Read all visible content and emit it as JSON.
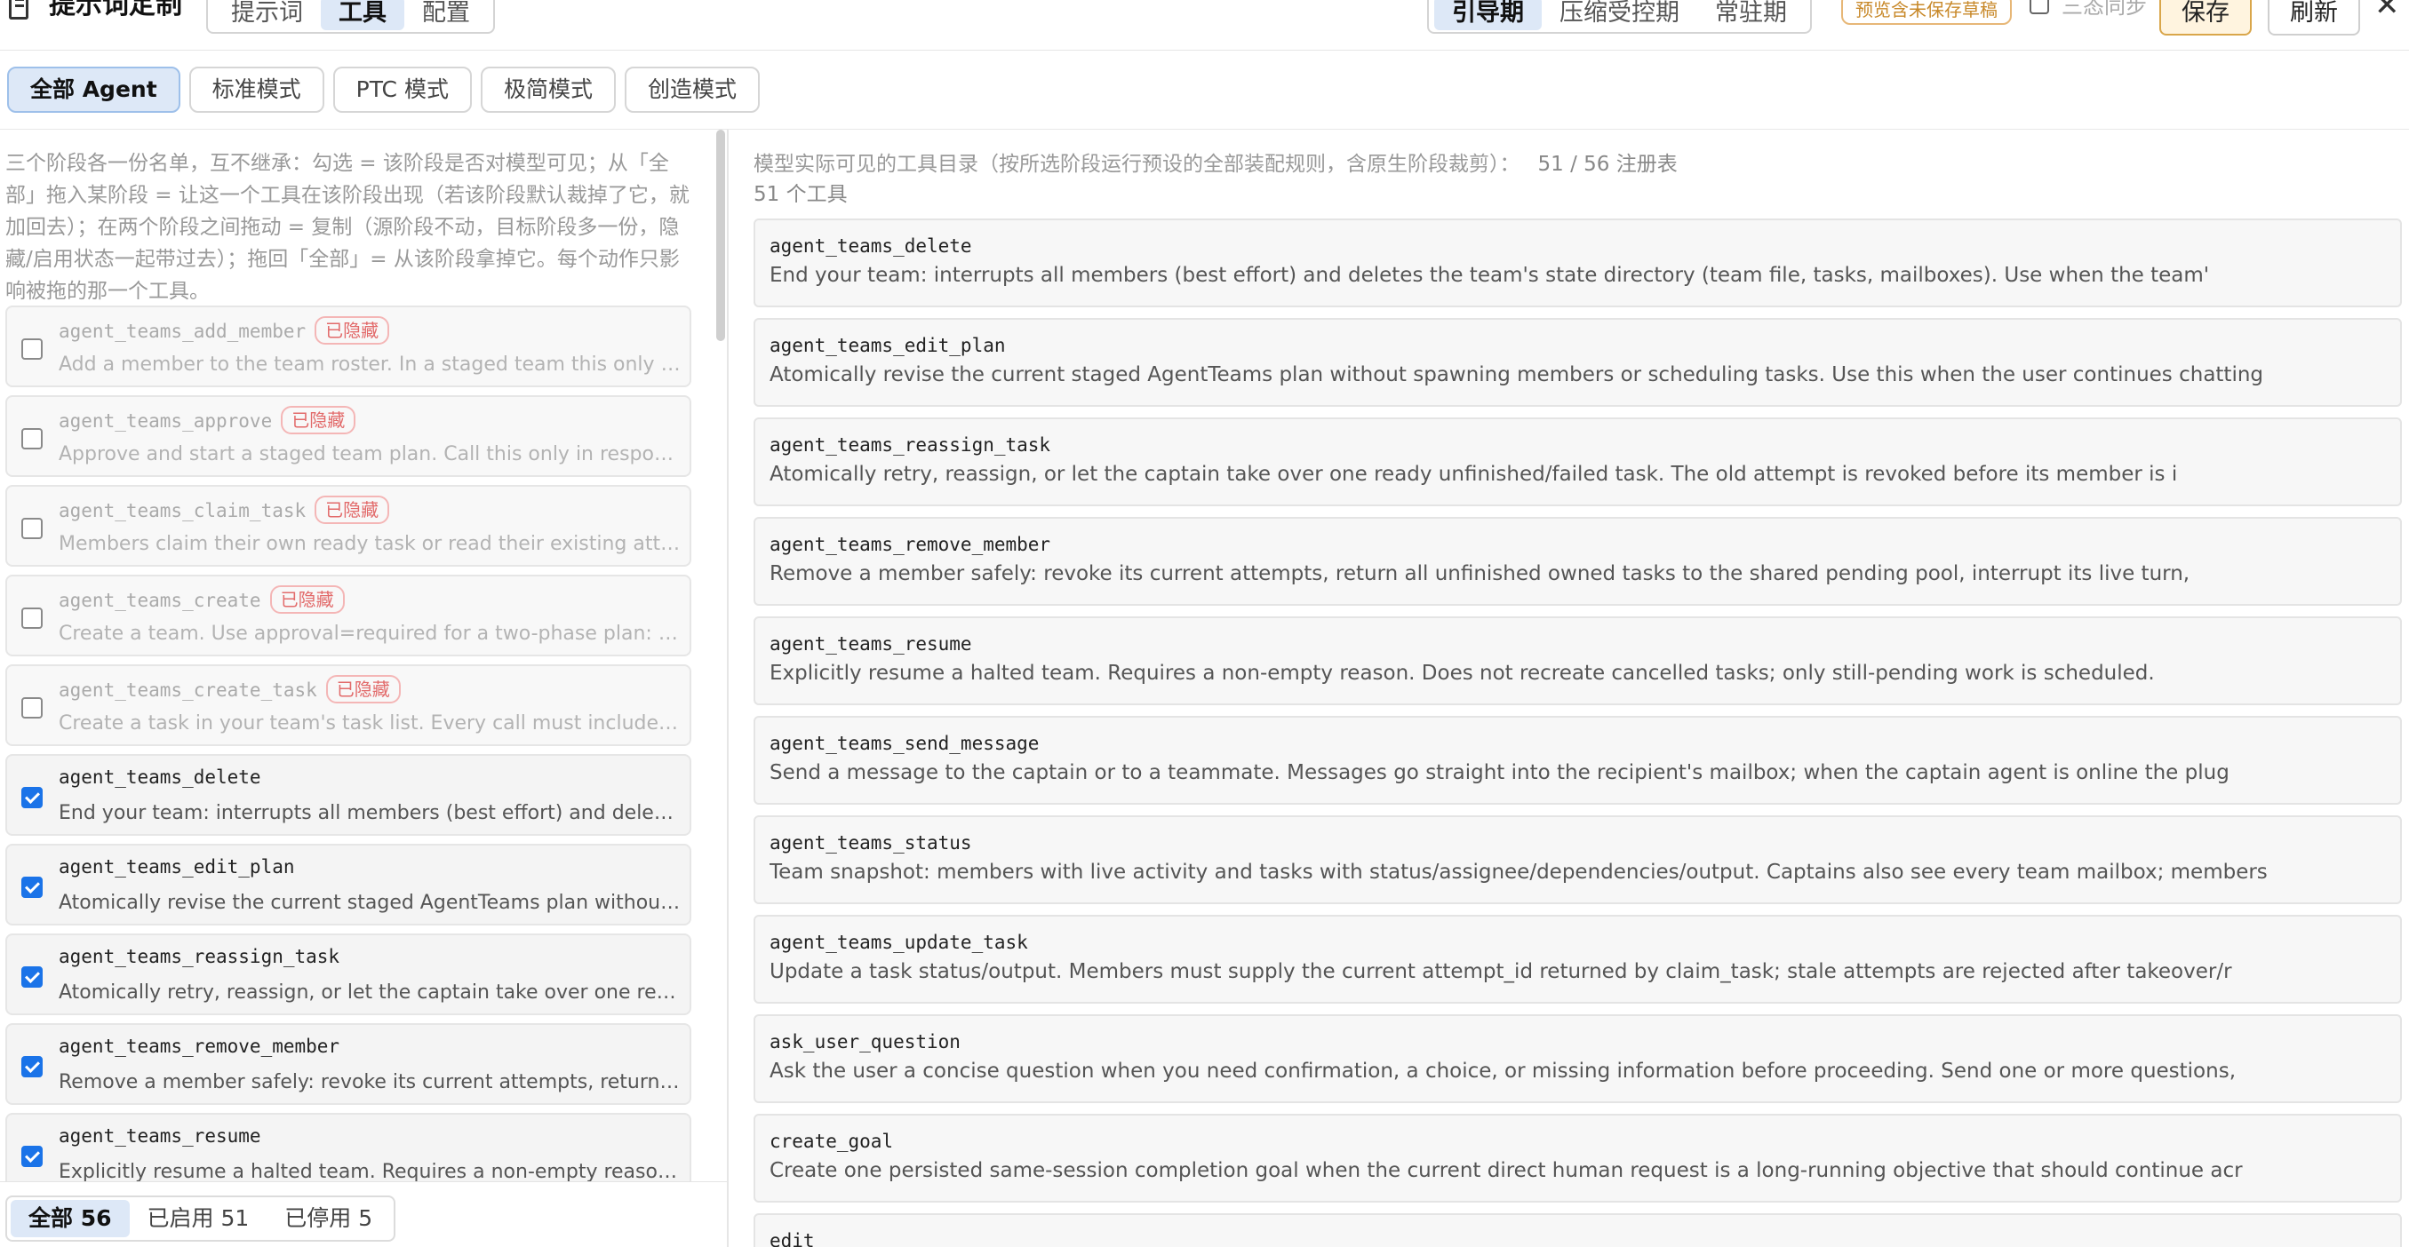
{
  "app": {
    "title": "提示词定制",
    "main_tabs": [
      "提示词",
      "工具",
      "配置"
    ],
    "phase_tabs": [
      "引导期",
      "压缩受控期",
      "常驻期"
    ],
    "draft_badge": "预览含未保存草稿",
    "sync_label": "三态同步",
    "save_label": "保存",
    "refresh_label": "刷新",
    "close_glyph": "✕"
  },
  "modes": [
    "全部 Agent",
    "标准模式",
    "PTC 模式",
    "极简模式",
    "创造模式"
  ],
  "left": {
    "description": "三个阶段各一份名单，互不继承：勾选 = 该阶段是否对模型可见；从「全部」拖入某阶段 = 让这一个工具在该阶段出现（若该阶段默认裁掉了它，就加回去）；在两个阶段之间拖动 = 复制（源阶段不动，目标阶段多一份，隐藏/启用状态一起带过去）；拖回「全部」= 从该阶段拿掉它。每个动作只影响被拖的那一个工具。",
    "hidden_badge": "已隐藏",
    "tools": [
      {
        "name": "agent_teams_add_member",
        "desc": "Add a member to the team roster. In a staged team this only adds the member to the plan",
        "checked": false,
        "hidden": true
      },
      {
        "name": "agent_teams_approve",
        "desc": "Approve and start a staged team plan. Call this only in response to the user approving",
        "checked": false,
        "hidden": true
      },
      {
        "name": "agent_teams_claim_task",
        "desc": "Members claim their own ready task or read their existing attempt details",
        "checked": false,
        "hidden": true
      },
      {
        "name": "agent_teams_create",
        "desc": "Create a team. Use approval=required for a two-phase plan: members and tasks",
        "checked": false,
        "hidden": true
      },
      {
        "name": "agent_teams_create_task",
        "desc": "Create a task in your team's task list. Every call must include a non-empty title",
        "checked": false,
        "hidden": true
      },
      {
        "name": "agent_teams_delete",
        "desc": "End your team: interrupts all members (best effort) and deletes the team's state directory",
        "checked": true,
        "hidden": false
      },
      {
        "name": "agent_teams_edit_plan",
        "desc": "Atomically revise the current staged AgentTeams plan without spawning members",
        "checked": true,
        "hidden": false
      },
      {
        "name": "agent_teams_reassign_task",
        "desc": "Atomically retry, reassign, or let the captain take over one ready unfinished task",
        "checked": true,
        "hidden": false
      },
      {
        "name": "agent_teams_remove_member",
        "desc": "Remove a member safely: revoke its current attempts, return all unfinished owned tasks",
        "checked": true,
        "hidden": false
      },
      {
        "name": "agent_teams_resume",
        "desc": "Explicitly resume a halted team. Requires a non-empty reason. Does not recreate",
        "checked": true,
        "hidden": false
      }
    ],
    "filters": [
      "全部 56",
      "已启用 51",
      "已停用 5"
    ]
  },
  "right": {
    "heading": "模型实际可见的工具目录（按所选阶段运行预设的全部装配规则，含原生阶段裁剪）：",
    "count_text": "51 / 56 注册表",
    "subcount": "51 个工具",
    "tools": [
      {
        "name": "agent_teams_delete",
        "desc": "End your team: interrupts all members (best effort) and deletes the team's state directory (team file, tasks, mailboxes). Use when the team'"
      },
      {
        "name": "agent_teams_edit_plan",
        "desc": "Atomically revise the current staged AgentTeams plan without spawning members or scheduling tasks. Use this when the user continues chatting"
      },
      {
        "name": "agent_teams_reassign_task",
        "desc": "Atomically retry, reassign, or let the captain take over one ready unfinished/failed task. The old attempt is revoked before its member is i"
      },
      {
        "name": "agent_teams_remove_member",
        "desc": "Remove a member safely: revoke its current attempts, return all unfinished owned tasks to the shared pending pool, interrupt its live turn,"
      },
      {
        "name": "agent_teams_resume",
        "desc": "Explicitly resume a halted team. Requires a non-empty reason. Does not recreate cancelled tasks; only still-pending work is scheduled."
      },
      {
        "name": "agent_teams_send_message",
        "desc": "Send a message to the captain or to a teammate. Messages go straight into the recipient's mailbox; when the captain agent is online the plug"
      },
      {
        "name": "agent_teams_status",
        "desc": "Team snapshot: members with live activity and tasks with status/assignee/dependencies/output. Captains also see every team mailbox; members"
      },
      {
        "name": "agent_teams_update_task",
        "desc": "Update a task status/output. Members must supply the current attempt_id returned by claim_task; stale attempts are rejected after takeover/r"
      },
      {
        "name": "ask_user_question",
        "desc": "Ask the user a concise question when you need confirmation, a choice, or missing information before proceeding. Send one or more questions,"
      },
      {
        "name": "create_goal",
        "desc": "Create one persisted same-session completion goal when the current direct human request is a long-running objective that should continue acr"
      },
      {
        "name": "edit",
        "desc": ""
      }
    ]
  }
}
